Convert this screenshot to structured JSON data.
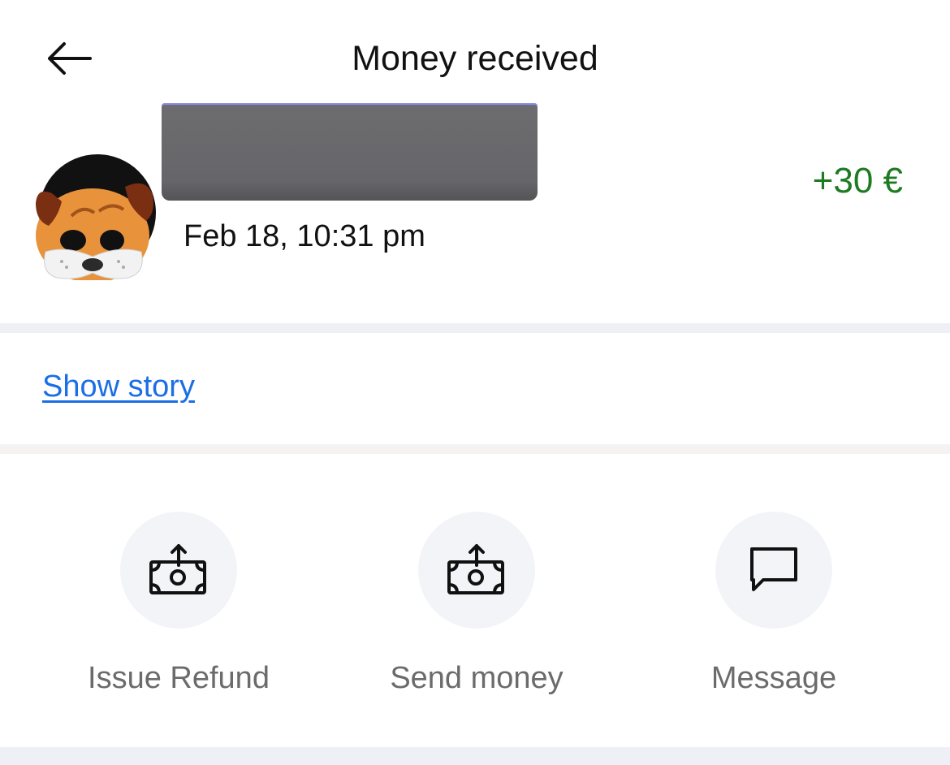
{
  "header": {
    "title": "Money received",
    "back_icon": "arrow-left-icon"
  },
  "transaction": {
    "date": "Feb 18, 10:31 pm",
    "amount": "+30 €",
    "amount_color": "#1e7a23",
    "avatar_icon": "dog-avatar-icon"
  },
  "story": {
    "link_label": "Show story",
    "link_color": "#1a6ee6"
  },
  "actions": [
    {
      "label": "Issue Refund",
      "icon": "money-send-icon"
    },
    {
      "label": "Send money",
      "icon": "money-send-icon"
    },
    {
      "label": "Message",
      "icon": "chat-bubble-icon"
    }
  ]
}
